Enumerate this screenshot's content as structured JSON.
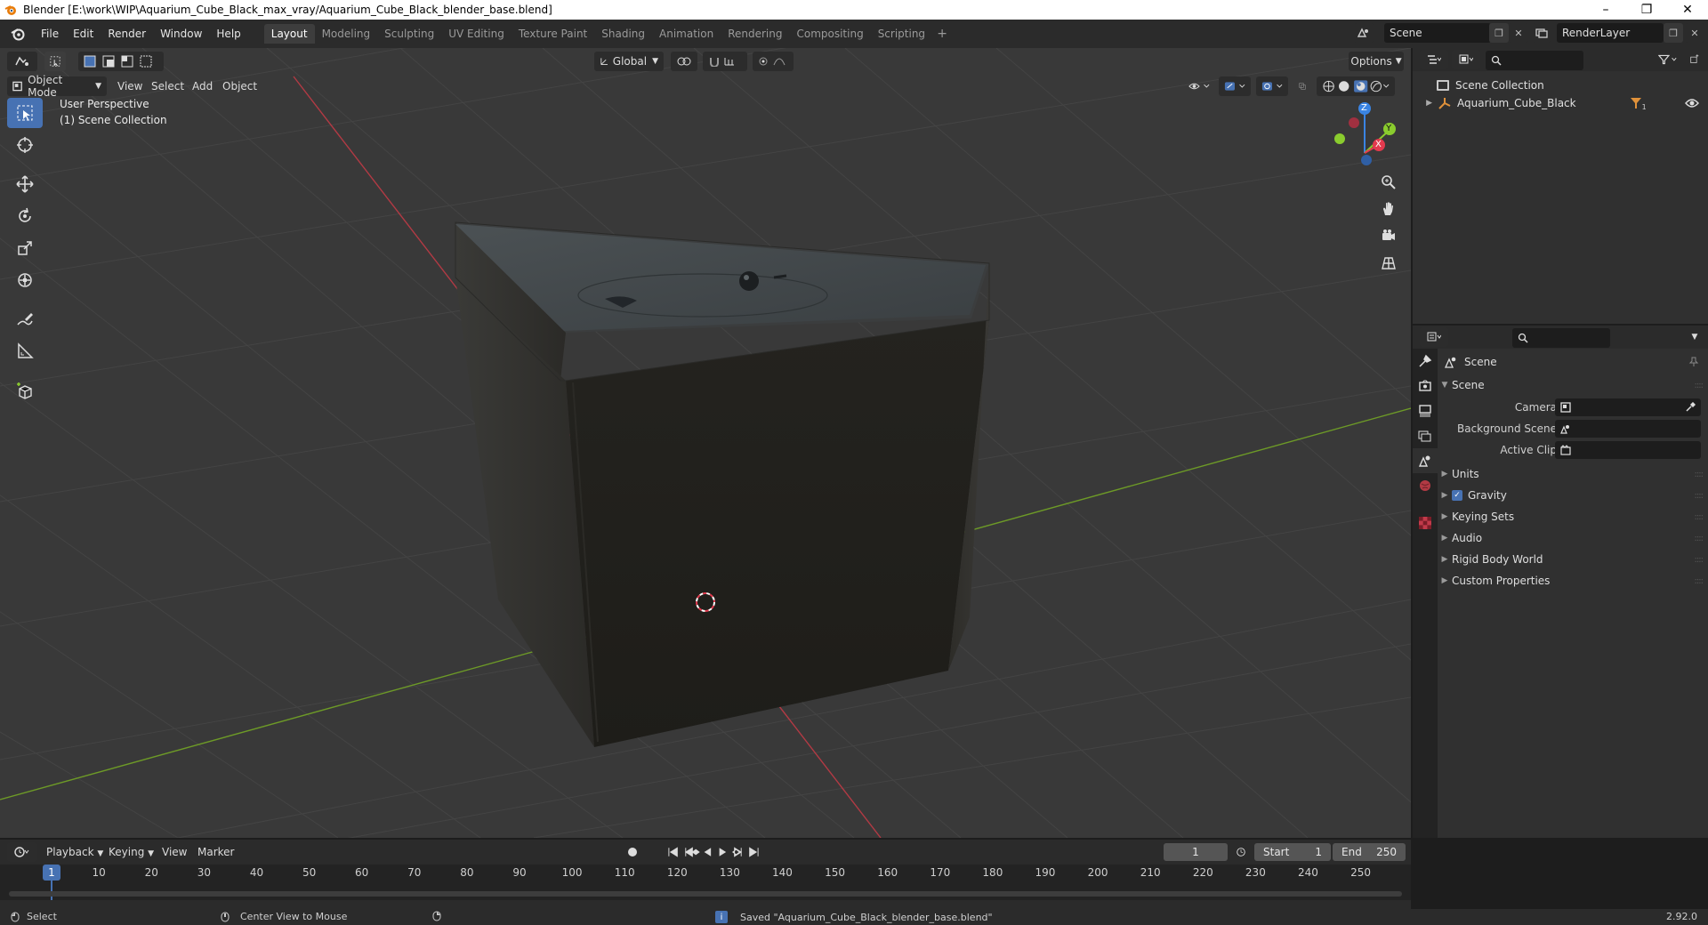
{
  "window": {
    "title": "Blender [E:\\work\\WIP\\Aquarium_Cube_Black_max_vray/Aquarium_Cube_Black_blender_base.blend]",
    "controls": [
      "–",
      "❐",
      "✕"
    ]
  },
  "menubar": {
    "items": [
      "File",
      "Edit",
      "Render",
      "Window",
      "Help"
    ],
    "workspaces": [
      "Layout",
      "Modeling",
      "Sculpting",
      "UV Editing",
      "Texture Paint",
      "Shading",
      "Animation",
      "Rendering",
      "Compositing",
      "Scripting"
    ],
    "active_workspace": "Layout",
    "add_tab": "+",
    "scene": "Scene",
    "view_layer": "RenderLayer"
  },
  "viewport": {
    "mode": "Object Mode",
    "menus": [
      "View",
      "Select",
      "Add",
      "Object"
    ],
    "orientation": "Global",
    "options_label": "Options",
    "overlay_line1": "User Perspective",
    "overlay_line2": "(1) Scene Collection",
    "gizmo_axes": [
      "Z",
      "Y",
      "X"
    ]
  },
  "outliner": {
    "root": "Scene Collection",
    "items": [
      {
        "name": "Aquarium_Cube_Black",
        "badge": "1"
      }
    ]
  },
  "properties": {
    "context": "Scene",
    "panel": "Scene",
    "fields": [
      {
        "label": "Camera"
      },
      {
        "label": "Background Scene"
      },
      {
        "label": "Active Clip"
      }
    ],
    "subpanels": [
      "Units",
      "Gravity",
      "Keying Sets",
      "Audio",
      "Rigid Body World",
      "Custom Properties"
    ],
    "gravity_checked": true
  },
  "timeline": {
    "menus": [
      "Playback",
      "Keying",
      "View",
      "Marker"
    ],
    "current_frame": "1",
    "start_label": "Start",
    "start": "1",
    "end_label": "End",
    "end": "250",
    "ruler": [
      "1",
      "10",
      "20",
      "30",
      "40",
      "50",
      "60",
      "70",
      "80",
      "90",
      "100",
      "110",
      "120",
      "130",
      "140",
      "150",
      "160",
      "170",
      "180",
      "190",
      "200",
      "210",
      "220",
      "230",
      "240",
      "250"
    ]
  },
  "statusbar": {
    "select": "Select",
    "center_view": "Center View to Mouse",
    "message": "Saved \"Aquarium_Cube_Black_blender_base.blend\"",
    "version": "2.92.0"
  },
  "colors": {
    "accent": "#4772b3",
    "x_axis": "#e33a4e",
    "y_axis": "#8acc2e",
    "z_axis": "#3a84e3",
    "cube_dark": "#1f1e1b"
  }
}
